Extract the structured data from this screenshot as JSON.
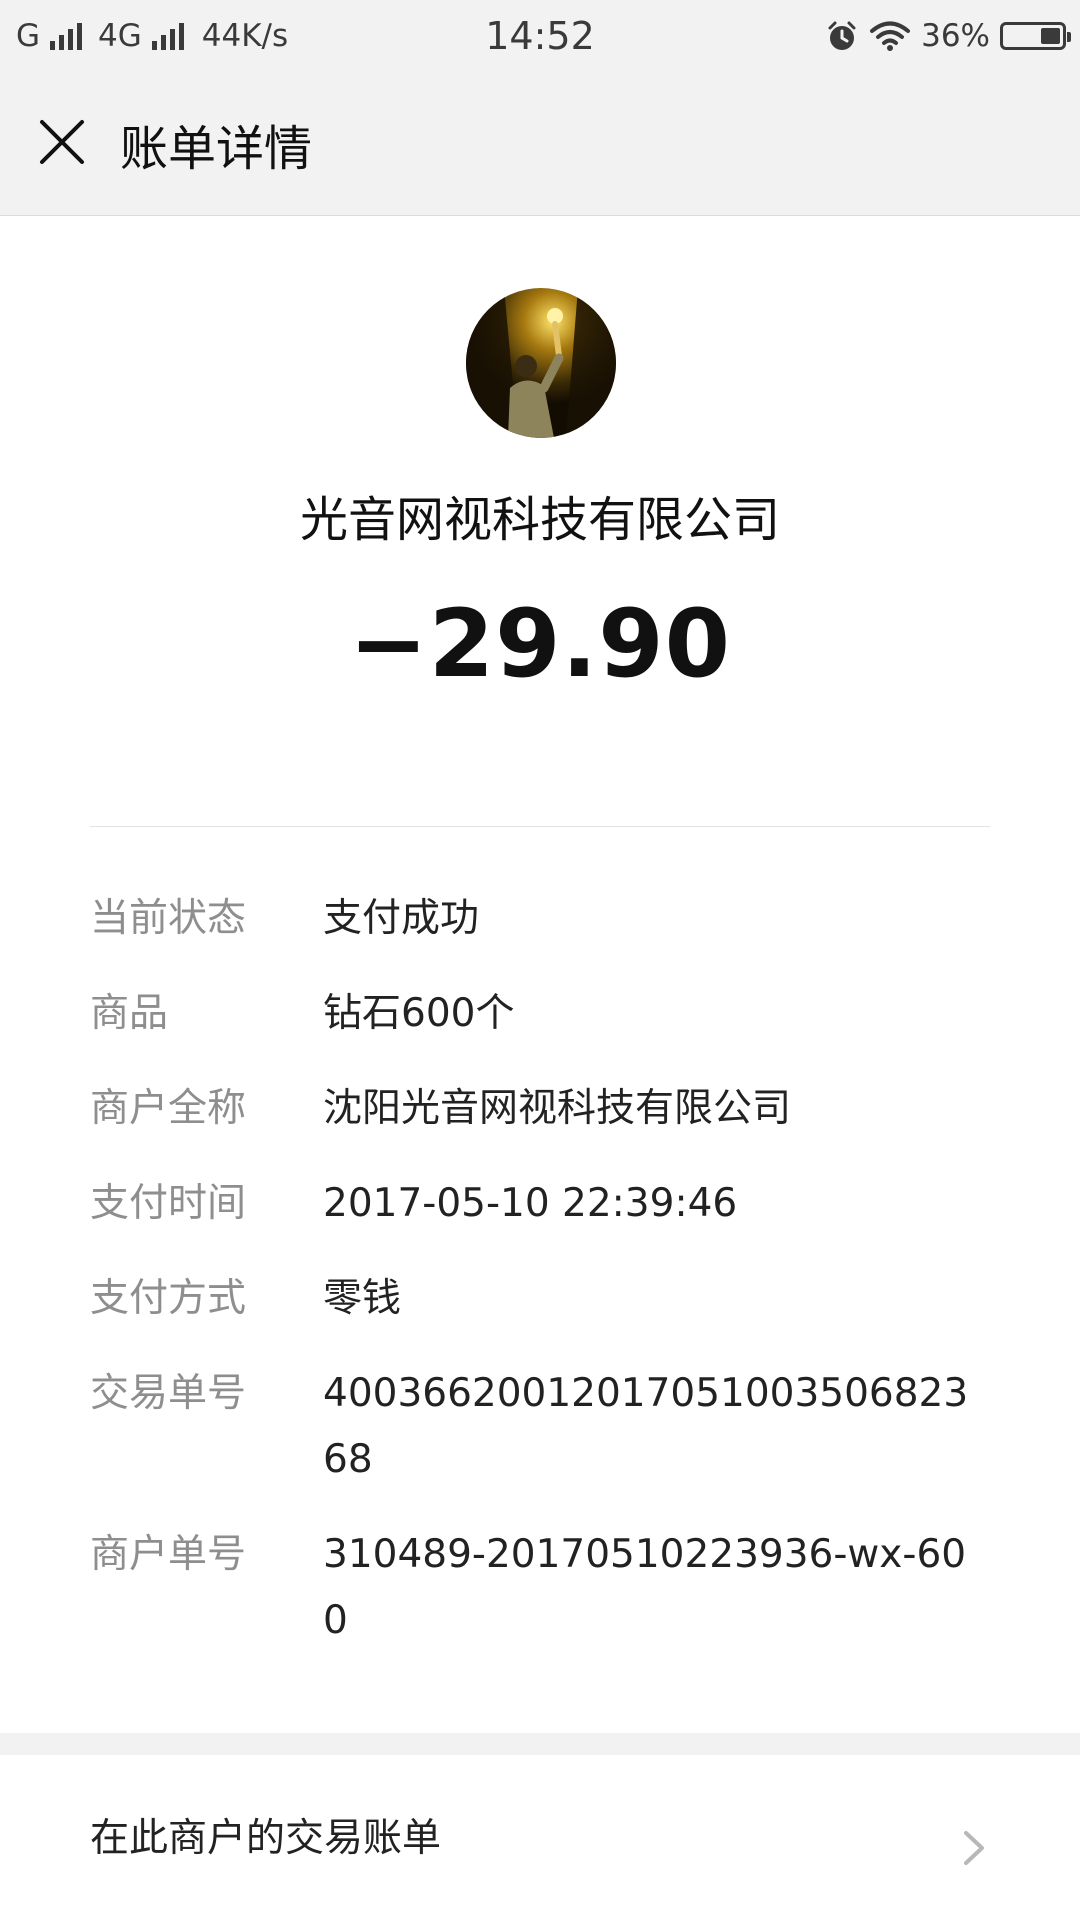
{
  "status_bar": {
    "carrier_left": "G",
    "network_type": "4G",
    "speed": "44K/s",
    "time": "14:52",
    "battery_percent": "36%",
    "battery_level": 0.36,
    "icons": [
      "signal-icon",
      "signal-icon",
      "alarm-icon",
      "wifi-icon",
      "battery-icon"
    ]
  },
  "nav": {
    "close_icon": "close-icon",
    "title": "账单详情"
  },
  "header": {
    "merchant_name": "光音网视科技有限公司",
    "amount": "−29.90"
  },
  "details": [
    {
      "label": "当前状态",
      "value": "支付成功"
    },
    {
      "label": "商品",
      "value": "钻石600个"
    },
    {
      "label": "商户全称",
      "value": "沈阳光音网视科技有限公司"
    },
    {
      "label": "支付时间",
      "value": "2017-05-10 22:39:46"
    },
    {
      "label": "支付方式",
      "value": "零钱"
    },
    {
      "label": "交易单号",
      "value": "4003662001201705100350682368"
    },
    {
      "label": "商户单号",
      "value": "310489-20170510223936-wx-600"
    }
  ],
  "footer_link": {
    "label": "在此商户的交易账单",
    "icon": "chevron-right-icon"
  },
  "colors": {
    "bar_background": "#f2f2f2",
    "label_gray": "#8e8e8e",
    "text": "#111111"
  }
}
